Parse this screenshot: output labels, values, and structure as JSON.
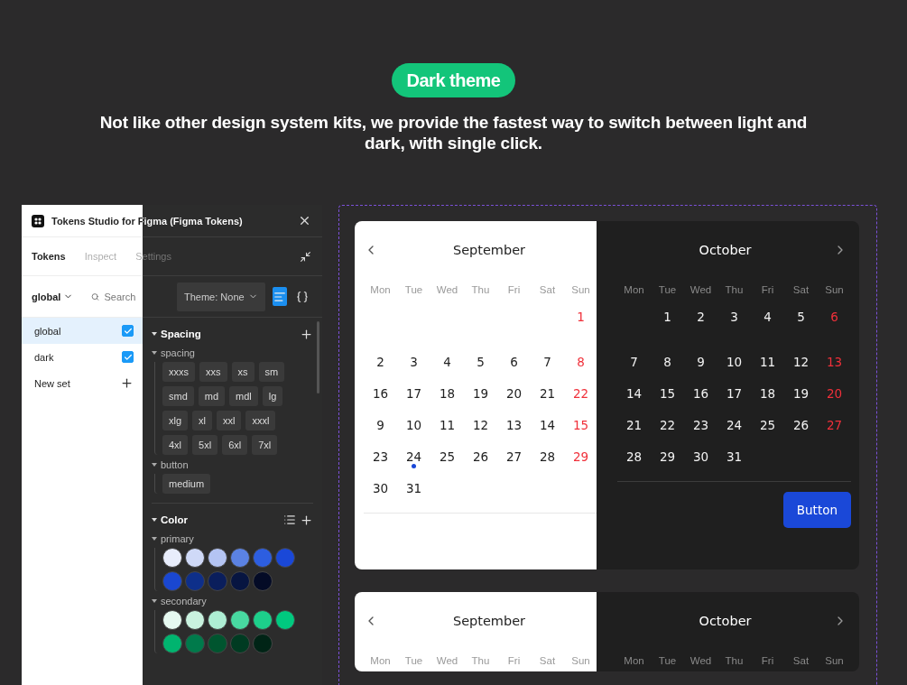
{
  "hero": {
    "badge": "Dark theme",
    "headline": "Not like other design system kits, we provide the fastest way to switch between light and dark, with single click."
  },
  "plugin": {
    "title": "Tokens Studio for Figma (Figma Tokens)",
    "tabs": [
      {
        "label": "Tokens",
        "selected": true
      },
      {
        "label": "Inspect",
        "selected": false
      },
      {
        "label": "Settings",
        "selected": false
      }
    ],
    "set_selector": "global",
    "search": {
      "placeholder": "Search"
    },
    "sets": [
      {
        "name": "global",
        "selected": true,
        "checked": true
      },
      {
        "name": "dark",
        "selected": false,
        "checked": true
      }
    ],
    "new_set": "New set",
    "theme_selector": "Theme: None",
    "view_modes": [
      {
        "kind": "list",
        "selected": true
      },
      {
        "kind": "json",
        "selected": false
      }
    ],
    "sections": [
      {
        "title": "Spacing",
        "kind": "size",
        "groups": [
          {
            "name": "spacing",
            "tokens": [
              "xxxs",
              "xxs",
              "xs",
              "sm",
              "smd",
              "md",
              "mdl",
              "lg",
              "xlg",
              "xl",
              "xxl",
              "xxxl",
              "4xl",
              "5xl",
              "6xl",
              "7xl"
            ]
          },
          {
            "name": "button",
            "tokens": [
              "medium"
            ]
          }
        ]
      },
      {
        "title": "Color",
        "kind": "color",
        "groups": [
          {
            "name": "primary",
            "tokens": [
              {
                "color": "#e8edfb"
              },
              {
                "color": "#cfd9f7"
              },
              {
                "color": "#b4c4f3"
              },
              {
                "color": "#5b82e3"
              },
              {
                "color": "#2d5ee0"
              },
              {
                "color": "#1a48d8"
              },
              {
                "color": "#1a47d1"
              },
              {
                "color": "#0e2f8a"
              },
              {
                "color": "#0a1e5c"
              },
              {
                "color": "#071541"
              },
              {
                "color": "#040b26"
              }
            ]
          },
          {
            "name": "secondary",
            "tokens": [
              {
                "color": "#e6f9f1"
              },
              {
                "color": "#c9f2df"
              },
              {
                "color": "#aeeed4"
              },
              {
                "color": "#48d9a1"
              },
              {
                "color": "#1dcf8b"
              },
              {
                "color": "#00c97f"
              },
              {
                "color": "#00b46f"
              },
              {
                "color": "#007a4b"
              },
              {
                "color": "#00552f"
              },
              {
                "color": "#003b22"
              },
              {
                "color": "#002416"
              }
            ]
          }
        ]
      }
    ]
  },
  "calendars": [
    {
      "months": [
        {
          "name": "September",
          "dark": false,
          "weekdays": [
            "Mon",
            "Tue",
            "Wed",
            "Thu",
            "Fri",
            "Sat",
            "Sun"
          ],
          "weeks": [
            {
              "right_aligned": true,
              "days": [
                {
                  "day": "1",
                  "dot": false
                }
              ]
            },
            {
              "days": [
                {
                  "day": "2",
                  "dot": false
                },
                {
                  "day": "3",
                  "dot": false
                },
                {
                  "day": "4",
                  "dot": false
                },
                {
                  "day": "5",
                  "dot": false
                },
                {
                  "day": "6",
                  "dot": false
                },
                {
                  "day": "7",
                  "dot": false
                },
                {
                  "day": "8",
                  "dot": false
                }
              ]
            },
            {
              "days": [
                {
                  "day": "16",
                  "dot": false
                },
                {
                  "day": "17",
                  "dot": false
                },
                {
                  "day": "18",
                  "dot": false
                },
                {
                  "day": "19",
                  "dot": false
                },
                {
                  "day": "20",
                  "dot": false
                },
                {
                  "day": "21",
                  "dot": false
                },
                {
                  "day": "22",
                  "dot": false
                }
              ]
            },
            {
              "days": [
                {
                  "day": "9",
                  "dot": false
                },
                {
                  "day": "10",
                  "dot": false
                },
                {
                  "day": "11",
                  "dot": false
                },
                {
                  "day": "12",
                  "dot": false
                },
                {
                  "day": "13",
                  "dot": false
                },
                {
                  "day": "14",
                  "dot": false
                },
                {
                  "day": "15",
                  "dot": false
                }
              ]
            },
            {
              "days": [
                {
                  "day": "23",
                  "dot": false
                },
                {
                  "day": "24",
                  "dot": true
                },
                {
                  "day": "25",
                  "dot": false
                },
                {
                  "day": "26",
                  "dot": false
                },
                {
                  "day": "27",
                  "dot": false
                },
                {
                  "day": "28",
                  "dot": false
                },
                {
                  "day": "29",
                  "dot": false
                }
              ]
            },
            {
              "right_aligned": false,
              "days": [
                {
                  "day": "30",
                  "dot": false
                },
                {
                  "day": "31",
                  "dot": false
                }
              ]
            }
          ]
        },
        {
          "name": "October",
          "dark": true,
          "weekdays": [
            "Mon",
            "Tue",
            "Wed",
            "Thu",
            "Fri",
            "Sat",
            "Sun"
          ],
          "weeks": [
            {
              "right_aligned": true,
              "days": [
                {
                  "day": "1",
                  "dot": false
                },
                {
                  "day": "2",
                  "dot": false
                },
                {
                  "day": "3",
                  "dot": false
                },
                {
                  "day": "4",
                  "dot": false
                },
                {
                  "day": "5",
                  "dot": false
                },
                {
                  "day": "6",
                  "dot": false
                }
              ]
            },
            {
              "days": [
                {
                  "day": "7",
                  "dot": false
                },
                {
                  "day": "8",
                  "dot": false
                },
                {
                  "day": "9",
                  "dot": false
                },
                {
                  "day": "10",
                  "dot": false
                },
                {
                  "day": "11",
                  "dot": false
                },
                {
                  "day": "12",
                  "dot": false
                },
                {
                  "day": "13",
                  "dot": false
                }
              ]
            },
            {
              "days": [
                {
                  "day": "14",
                  "dot": false
                },
                {
                  "day": "15",
                  "dot": false
                },
                {
                  "day": "16",
                  "dot": false
                },
                {
                  "day": "17",
                  "dot": false
                },
                {
                  "day": "18",
                  "dot": false
                },
                {
                  "day": "19",
                  "dot": false
                },
                {
                  "day": "20",
                  "dot": false
                }
              ]
            },
            {
              "days": [
                {
                  "day": "21",
                  "dot": false
                },
                {
                  "day": "22",
                  "dot": false
                },
                {
                  "day": "23",
                  "dot": false
                },
                {
                  "day": "24",
                  "dot": false
                },
                {
                  "day": "25",
                  "dot": false
                },
                {
                  "day": "26",
                  "dot": false
                },
                {
                  "day": "27",
                  "dot": false
                }
              ]
            },
            {
              "right_aligned": false,
              "days": [
                {
                  "day": "28",
                  "dot": false
                },
                {
                  "day": "29",
                  "dot": false
                },
                {
                  "day": "30",
                  "dot": false
                },
                {
                  "day": "31",
                  "dot": false
                }
              ]
            }
          ]
        }
      ],
      "button": "Button"
    },
    {
      "months": [
        {
          "name": "September",
          "dark": false,
          "weekdays": [
            "Mon",
            "Tue",
            "Wed",
            "Thu",
            "Fri",
            "Sat",
            "Sun"
          ]
        },
        {
          "name": "October",
          "dark": true,
          "weekdays": [
            "Mon",
            "Tue",
            "Wed",
            "Thu",
            "Fri",
            "Sat",
            "Sun"
          ]
        }
      ]
    }
  ]
}
